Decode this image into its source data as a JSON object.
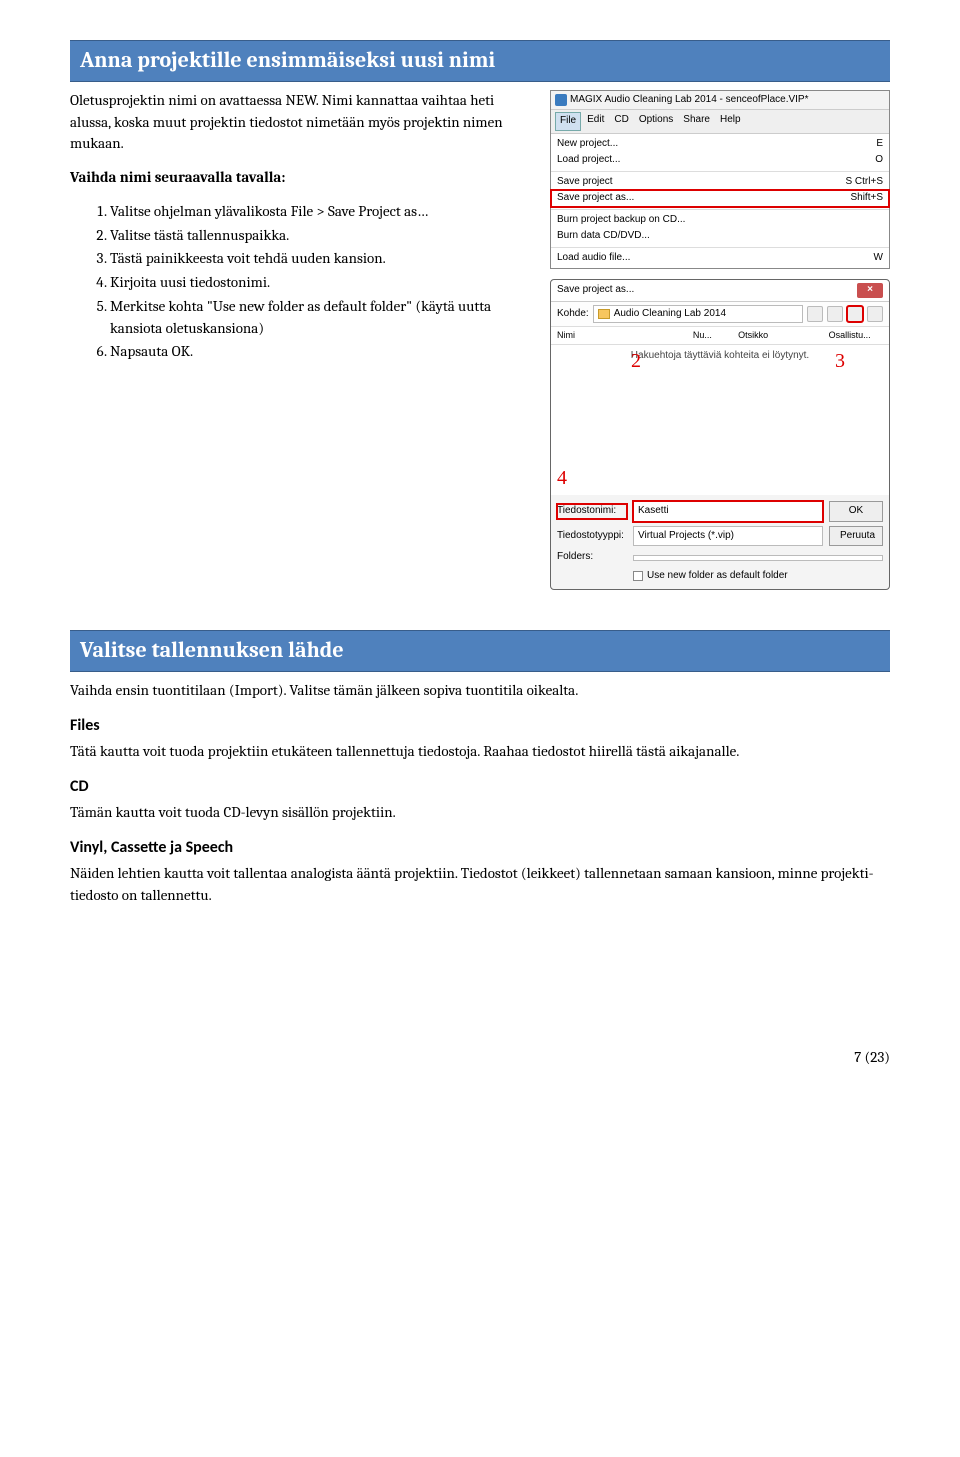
{
  "heading1": "Anna projektille ensimmäiseksi uusi nimi",
  "intro1": "Oletusprojektin nimi on avattaessa NEW. Nimi kannattaa vaihtaa heti alussa, koska muut projektin tiedostot nimetään myös projektin nimen mukaan.",
  "bold1": "Vaihda nimi seuraavalla tavalla:",
  "steps": [
    "Valitse ohjelman ylävalikosta File > Save Project as…",
    "Valitse tästä tallennuspaikka.",
    "Tästä painikkeesta voit tehdä uuden kansion.",
    "Kirjoita uusi tiedostonimi.",
    "Merkitse kohta \"Use new folder as default folder\" (käytä uutta kansiota oletuskansiona)",
    "Napsauta OK."
  ],
  "menu": {
    "title": "MAGIX Audio Cleaning Lab 2014  -  senceofPlace.VIP*",
    "menubar": [
      "File",
      "Edit",
      "CD",
      "Options",
      "Share",
      "Help"
    ],
    "items": [
      {
        "label": "New project...",
        "short": "E"
      },
      {
        "label": "Load project...",
        "short": "O"
      },
      {
        "sep": true
      },
      {
        "label": "Save project",
        "short": "S  Ctrl+S"
      },
      {
        "label": "Save project as...",
        "short": "Shift+S",
        "hl": true
      },
      {
        "sep": true
      },
      {
        "label": "Burn project backup on CD...",
        "short": ""
      },
      {
        "label": "Burn data CD/DVD...",
        "short": ""
      },
      {
        "sep": true
      },
      {
        "label": "Load audio file...",
        "short": "W"
      }
    ]
  },
  "dialog": {
    "title": "Save project as...",
    "close": "×",
    "kohde_label": "Kohde:",
    "kohde_value": "Audio Cleaning Lab 2014",
    "list_headers": [
      "Nimi",
      "Nu...",
      "Otsikko",
      "Osallistu..."
    ],
    "empty_text": "Hakuehtoja täyttäviä kohteita ei löytynyt.",
    "file_label": "Tiedostonimi:",
    "file_value": "Kasetti",
    "type_label": "Tiedostotyyppi:",
    "type_value": "Virtual Projects (*.vip)",
    "folders_label": "Folders:",
    "chk_label": "Use new folder as default folder",
    "ok": "OK",
    "cancel": "Peruuta",
    "callouts": {
      "c2": "2",
      "c3": "3",
      "c4": "4"
    }
  },
  "heading2": "Valitse tallennuksen lähde",
  "para2a": "Vaihda ensin tuontitilaan (Import). Valitse tämän jälkeen sopiva tuontitila oikealta.",
  "sub_files": "Files",
  "para_files": "Tätä kautta voit tuoda projektiin etukäteen tallennettuja tiedostoja. Raahaa tiedostot hiirellä tästä aikajanalle.",
  "sub_cd": "CD",
  "para_cd": "Tämän kautta voit tuoda CD-levyn sisällön projektiin.",
  "sub_vcs": "Vinyl, Cassette ja Speech",
  "para_vcs": "Näiden lehtien kautta voit tallentaa analogista ääntä projektiin. Tiedostot (leikkeet) tallennetaan samaan kansioon, minne projekti-tiedosto on tallennettu.",
  "footer": "7 (23)"
}
